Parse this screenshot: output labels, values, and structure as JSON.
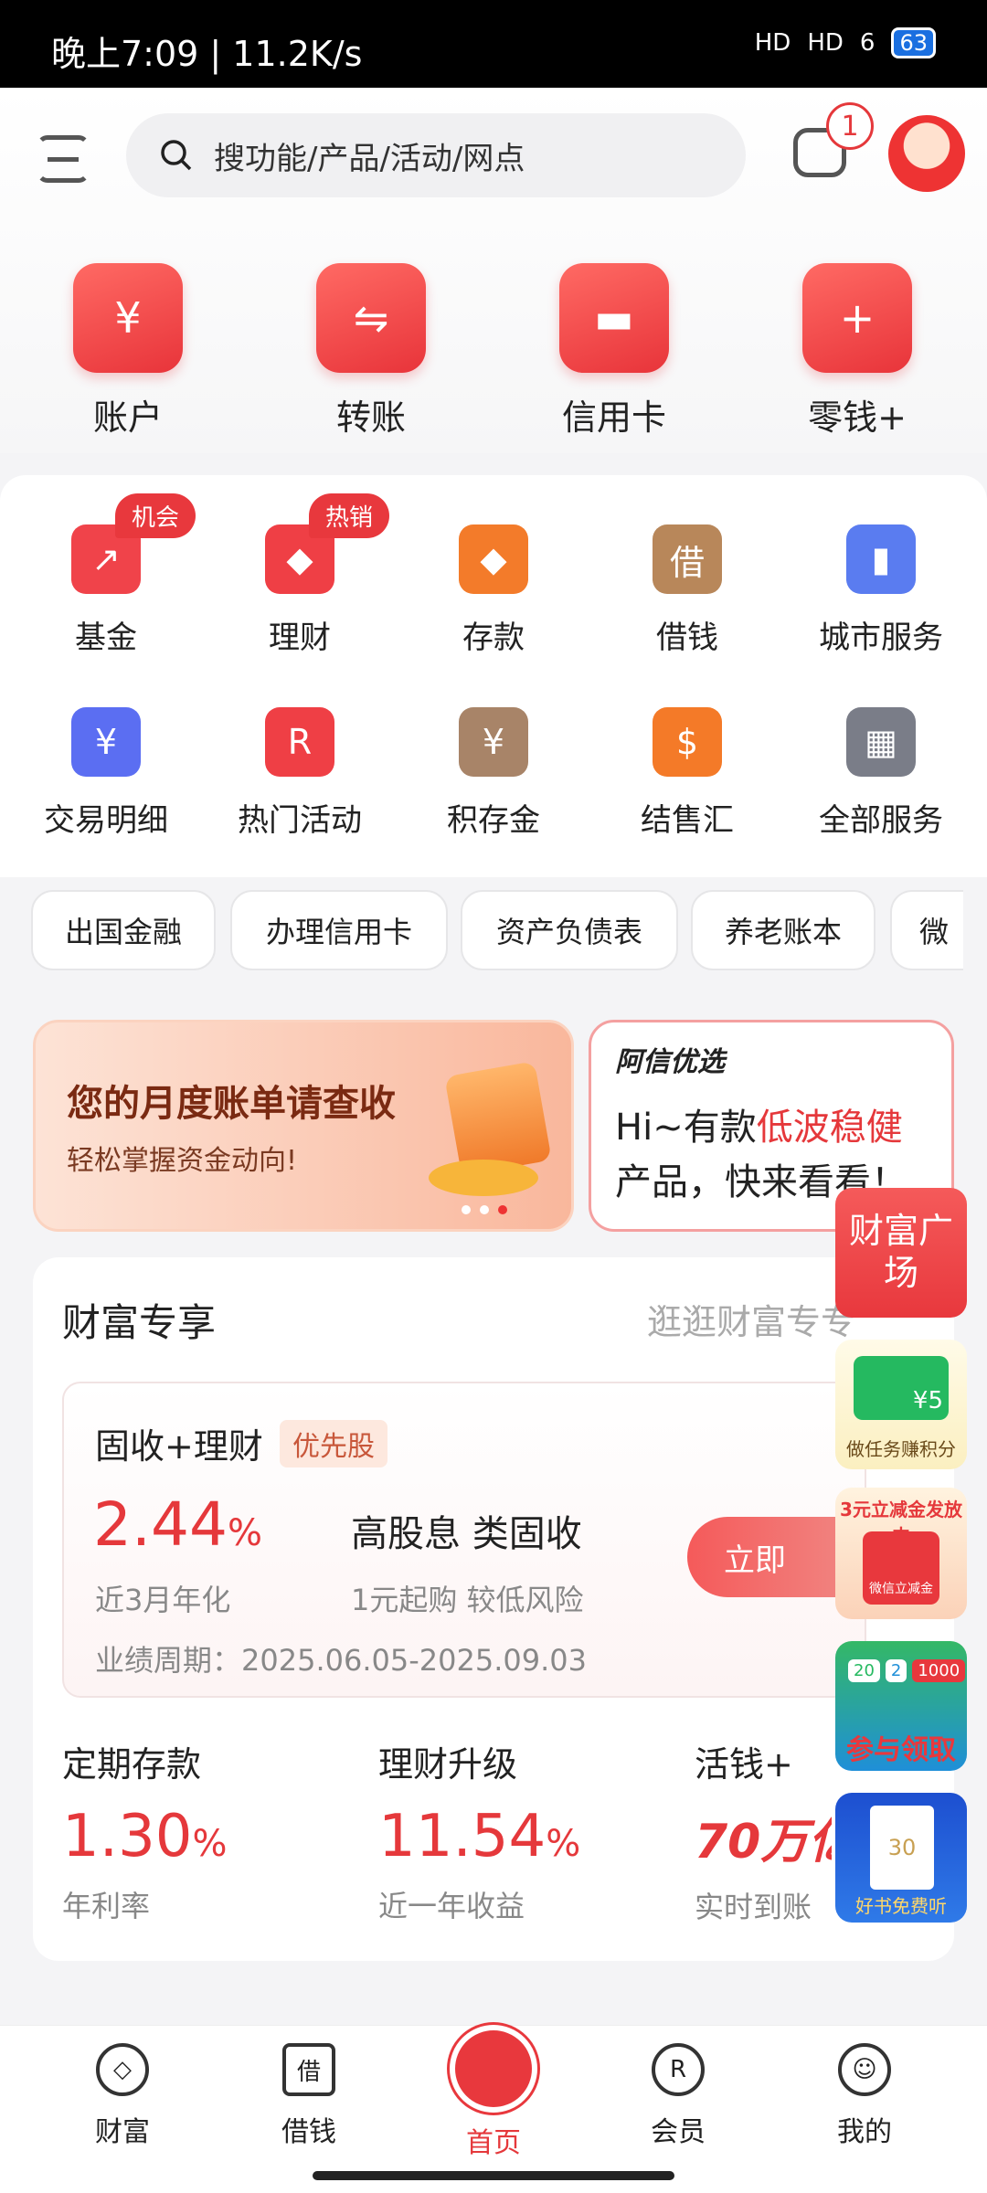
{
  "status_bar": {
    "time": "晚上7:09 | 11.2K/s",
    "signal1": "HD",
    "signal2": "HD",
    "wifi": "6",
    "battery": "63"
  },
  "header": {
    "search_placeholder": "搜功能/产品/活动/网点",
    "message_count": "1"
  },
  "top_actions": [
    {
      "label": "账户",
      "icon": "¥"
    },
    {
      "label": "转账",
      "icon": "⇋"
    },
    {
      "label": "信用卡",
      "icon": "▬"
    },
    {
      "label": "零钱+",
      "icon": "+"
    }
  ],
  "services": [
    {
      "label": "基金",
      "tag": "机会",
      "color": "#f0434a",
      "icon": "↗"
    },
    {
      "label": "理财",
      "tag": "热销",
      "color": "#ef3f45",
      "icon": "◆"
    },
    {
      "label": "存款",
      "tag": "",
      "color": "#f37b2a",
      "icon": "◆"
    },
    {
      "label": "借钱",
      "tag": "",
      "color": "#b8875a",
      "icon": "借"
    },
    {
      "label": "城市服务",
      "tag": "",
      "color": "#5a7cf0",
      "icon": "▮"
    },
    {
      "label": "交易明细",
      "tag": "",
      "color": "#5b6ef2",
      "icon": "¥"
    },
    {
      "label": "热门活动",
      "tag": "",
      "color": "#ef3f45",
      "icon": "R"
    },
    {
      "label": "积存金",
      "tag": "",
      "color": "#a88468",
      "icon": "¥"
    },
    {
      "label": "结售汇",
      "tag": "",
      "color": "#f47a28",
      "icon": "$"
    },
    {
      "label": "全部服务",
      "tag": "",
      "color": "#7a7d88",
      "icon": "▦"
    }
  ],
  "chips": [
    "出国金融",
    "办理信用卡",
    "资产负债表",
    "养老账本",
    "微"
  ],
  "banner_bill": {
    "title": "您的月度账单请查收",
    "subtitle": "轻松掌握资金动向!"
  },
  "banner_promo": {
    "brand": "阿信优选",
    "line1_prefix": "Hi~有款",
    "line1_highlight": "低波稳健",
    "line2": "产品，快来看看！"
  },
  "wealth": {
    "title": "财富专享",
    "more": "逛逛财富专专",
    "product": {
      "name": "固收+理财",
      "tag": "优先股",
      "rate": "2.44",
      "rate_unit": "%",
      "rate_label": "近3月年化",
      "feature": "高股息 类固收",
      "feature_sub": "1元起购 较低风险",
      "period": "业绩周期：2025.06.05-2025.09.03",
      "button": "立即"
    },
    "items": [
      {
        "title": "定期存款",
        "value": "1.30",
        "unit": "%",
        "label": "年利率"
      },
      {
        "title": "理财升级",
        "value": "11.54",
        "unit": "%",
        "label": "近一年收益"
      },
      {
        "title": "活钱+",
        "value": "70万亿",
        "unit": "",
        "label": "实时到账"
      }
    ]
  },
  "floating": {
    "plaza": "财富广场",
    "task": "做任务赚积分",
    "task_amount": "¥5",
    "coupon": "3元立减金发放中",
    "coupon_sub": "微信立减金",
    "join": "参与领取",
    "join_vals": [
      "20",
      "2",
      "1000"
    ],
    "book": "好书免费听",
    "book_num": "30"
  },
  "nav": [
    {
      "label": "财富",
      "icon": "◇"
    },
    {
      "label": "借钱",
      "icon": "借"
    },
    {
      "label": "首页",
      "icon": ""
    },
    {
      "label": "会员",
      "icon": "R"
    },
    {
      "label": "我的",
      "icon": "☺"
    }
  ]
}
